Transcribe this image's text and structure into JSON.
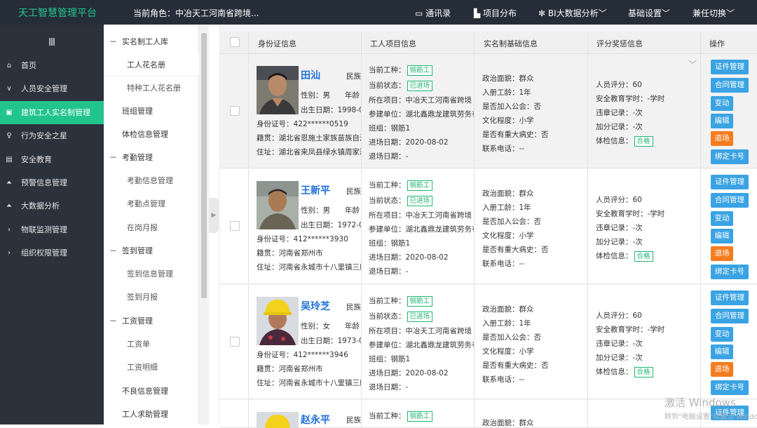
{
  "app": {
    "title": "天工智慧管理平台",
    "role": "当前角色：中冶天工河南省跨境..."
  },
  "topnav": {
    "contacts": "通讯录",
    "projects": "项目分布",
    "bigdata": "BI大数据分析",
    "settings": "基础设置",
    "switch": "兼任切换"
  },
  "sidebar": {
    "items": [
      {
        "label": "首页",
        "icon": "home-icon"
      },
      {
        "label": "人员安全管理",
        "icon": "chevron-down-icon"
      },
      {
        "label": "建筑工人实名制管理",
        "icon": "id-card-icon"
      },
      {
        "label": "行为安全之星",
        "icon": "user-icon"
      },
      {
        "label": "安全教育",
        "icon": "book-icon"
      },
      {
        "label": "预警信息管理",
        "icon": "chart-icon"
      },
      {
        "label": "大数据分析",
        "icon": "chart-icon"
      },
      {
        "label": "物联监测管理",
        "icon": "chevron-right-icon"
      },
      {
        "label": "组织权限管理",
        "icon": "chevron-right-icon"
      }
    ]
  },
  "subnav": {
    "g1": "实名制工人库",
    "roster": "工人花名册",
    "special": "特种工人花名册",
    "team": "班组管理",
    "health": "体检信息管理",
    "g2": "考勤管理",
    "att_info": "考勤信息管理",
    "att_point": "考勤点管理",
    "monthly": "在岗月报",
    "g3": "签到管理",
    "sign_info": "签到信息管理",
    "sign_month": "签到月报",
    "g4": "工资管理",
    "payroll": "工资单",
    "pay_detail": "工资明细",
    "bad": "不良信息管理",
    "help": "工人求助管理"
  },
  "table": {
    "headers": {
      "id": "身份证信息",
      "project": "工人项目信息",
      "basic": "实名制基础信息",
      "eval": "评分奖惩信息",
      "ops": "操作"
    }
  },
  "labels": {
    "nation": "民族",
    "age": "年龄",
    "gender": "性别：",
    "birth": "出生日期：",
    "idno": "身份证号：",
    "origin": "籍贯：",
    "address": "住址：",
    "trade": "当前工种：",
    "status": "当前状态：",
    "proj": "所在项目：",
    "unit": "参建单位：",
    "group": "班组：",
    "enter": "进场日期：",
    "exit": "退场日期：",
    "political": "政治面貌：",
    "seniority": "入册工龄：",
    "union": "是否加入公会：",
    "education": "文化程度：",
    "illness": "是否有重大病史：",
    "phone": "联系电话：",
    "score": "人员评分：",
    "hours": "安全教育学时：",
    "violation": "违章记录：",
    "bonus": "加分记录：",
    "physical": "体检信息："
  },
  "buttons": {
    "cert": "证件管理",
    "contract": "合同管理",
    "change": "变动",
    "edit": "编辑",
    "leave": "退场",
    "bind": "绑定卡号"
  },
  "workers": [
    {
      "name": "田汕",
      "gender": "男",
      "birth": "1998-0",
      "idno": "422******0519",
      "origin": "湖北省恩施土家族苗族自治",
      "address": "湖北省来凤县绿水镇周家湾",
      "trade": "钢筋工",
      "status": "已进场",
      "project": "中冶天工河南省跨境",
      "unit": "湖北鑫鼎龙建筑劳务有",
      "group": "钢筋1",
      "enter": "2020-08-02",
      "exit": "-",
      "political": "群众",
      "seniority": "1年",
      "union": "否",
      "education": "小学",
      "illness": "否",
      "phone": "--",
      "score": "60",
      "hours": "-学时",
      "violation": "-次",
      "bonus": "-次",
      "physical": "合格"
    },
    {
      "name": "王新平",
      "gender": "男",
      "birth": "1972-0",
      "idno": "412******3930",
      "origin": "河南省郑州市",
      "address": "河南省永城市十八里镇三座",
      "trade": "钢筋工",
      "status": "已进场",
      "project": "中冶天工河南省跨境",
      "unit": "湖北鑫鼎龙建筑劳务有",
      "group": "钢筋1",
      "enter": "2020-08-02",
      "exit": "-",
      "political": "群众",
      "seniority": "1年",
      "union": "否",
      "education": "小学",
      "illness": "否",
      "phone": "--",
      "score": "60",
      "hours": "-学时",
      "violation": "-次",
      "bonus": "-次",
      "physical": "合格"
    },
    {
      "name": "吴玲芝",
      "gender": "女",
      "birth": "1973-0",
      "idno": "412******3946",
      "origin": "河南省郑州市",
      "address": "河南省永城市十八里镇三座",
      "trade": "钢筋工",
      "status": "已进场",
      "project": "中冶天工河南省跨境",
      "unit": "湖北鑫鼎龙建筑劳务有",
      "group": "钢筋1",
      "enter": "2020-08-02",
      "exit": "-",
      "political": "群众",
      "seniority": "1年",
      "union": "否",
      "education": "小学",
      "illness": "否",
      "phone": "--",
      "score": "60",
      "hours": "-学时",
      "violation": "-次",
      "bonus": "-次",
      "physical": "合格"
    },
    {
      "name": "赵永平",
      "trade": "钢筋工",
      "political": "群众"
    }
  ],
  "watermark": {
    "line1": "激活 Windows",
    "line2": "转到\"电脑设置\"以激活 Windows"
  },
  "colors": {
    "brand": "#22c48d",
    "accent": "#3aa3e3",
    "warning": "#f57c1f",
    "link": "#1e6fd9",
    "topbar": "#252d38",
    "sidebar": "#2b323b"
  }
}
